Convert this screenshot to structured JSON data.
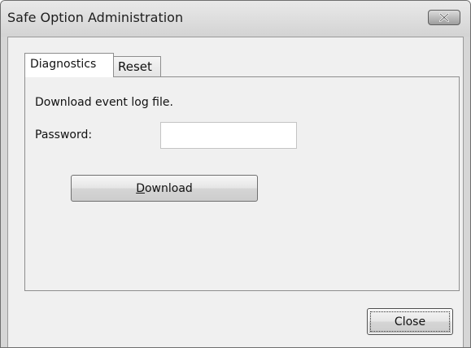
{
  "window": {
    "title": "Safe Option Administration",
    "close_icon": "close-x-icon"
  },
  "tabs": [
    {
      "label": "Diagnostics",
      "active": true
    },
    {
      "label": "Reset",
      "active": false
    }
  ],
  "diagnostics": {
    "description": "Download event log file.",
    "password_label": "Password:",
    "password_value": "",
    "download_button": {
      "mnemonic": "D",
      "rest": "ownload"
    }
  },
  "footer": {
    "close_label": "Close"
  }
}
